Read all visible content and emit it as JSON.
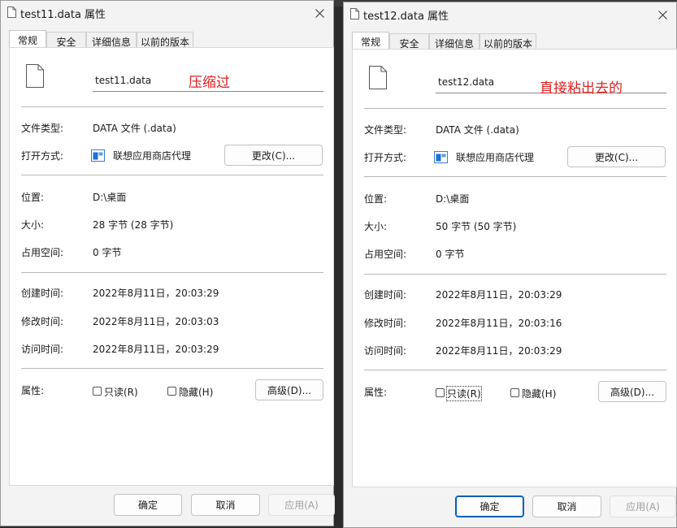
{
  "windows": [
    {
      "title": "test11.data 属性",
      "tabs": [
        "常规",
        "安全",
        "详细信息",
        "以前的版本"
      ],
      "file_name": "test11.data",
      "annotation": "压缩过",
      "fields": {
        "type_label": "文件类型:",
        "type_value": "DATA 文件 (.data)",
        "open_label": "打开方式:",
        "open_value": "联想应用商店代理",
        "change_button": "更改(C)...",
        "location_label": "位置:",
        "location_value": "D:\\桌面",
        "size_label": "大小:",
        "size_value": "28 字节 (28 字节)",
        "disk_label": "占用空间:",
        "disk_value": "0 字节",
        "created_label": "创建时间:",
        "created_value": "2022年8月11日，20:03:29",
        "modified_label": "修改时间:",
        "modified_value": "2022年8月11日，20:03:03",
        "accessed_label": "访问时间:",
        "accessed_value": "2022年8月11日，20:03:29",
        "attr_label": "属性:",
        "readonly_label": "只读(R)",
        "hidden_label": "隐藏(H)",
        "advanced_button": "高级(D)..."
      },
      "buttons": {
        "ok": "确定",
        "cancel": "取消",
        "apply": "应用(A)"
      }
    },
    {
      "title": "test12.data 属性",
      "tabs": [
        "常规",
        "安全",
        "详细信息",
        "以前的版本"
      ],
      "file_name": "test12.data",
      "annotation": "直接粘出去的",
      "fields": {
        "type_label": "文件类型:",
        "type_value": "DATA 文件 (.data)",
        "open_label": "打开方式:",
        "open_value": "联想应用商店代理",
        "change_button": "更改(C)...",
        "location_label": "位置:",
        "location_value": "D:\\桌面",
        "size_label": "大小:",
        "size_value": "50 字节 (50 字节)",
        "disk_label": "占用空间:",
        "disk_value": "0 字节",
        "created_label": "创建时间:",
        "created_value": "2022年8月11日，20:03:29",
        "modified_label": "修改时间:",
        "modified_value": "2022年8月11日，20:03:16",
        "accessed_label": "访问时间:",
        "accessed_value": "2022年8月11日，20:03:29",
        "attr_label": "属性:",
        "readonly_label": "只读(R)",
        "hidden_label": "隐藏(H)",
        "advanced_button": "高级(D)..."
      },
      "buttons": {
        "ok": "确定",
        "cancel": "取消",
        "apply": "应用(A)"
      }
    }
  ],
  "icons": {
    "file": "file-icon",
    "close": "close-icon",
    "app": "lenovo-store-icon"
  },
  "colors": {
    "annotation": "#e02020",
    "accent": "#005fb8"
  }
}
